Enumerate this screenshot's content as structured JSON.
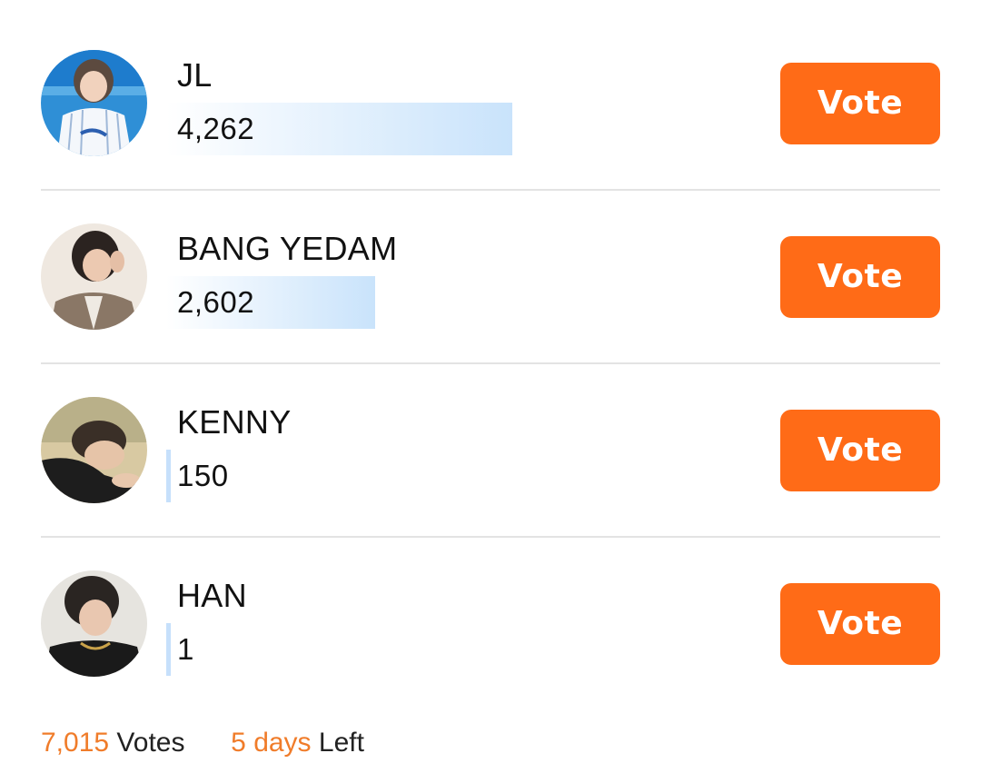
{
  "colors": {
    "accent": "#ff6b17",
    "footer_accent": "#f07c2a",
    "bar": "#c9e3fb",
    "divider": "#e3e3e3"
  },
  "candidates": [
    {
      "name": "JL",
      "votes": "4,262",
      "vote_label": "Vote"
    },
    {
      "name": "BANG YEDAM",
      "votes": "2,602",
      "vote_label": "Vote"
    },
    {
      "name": "KENNY",
      "votes": "150",
      "vote_label": "Vote"
    },
    {
      "name": "HAN",
      "votes": "1",
      "vote_label": "Vote"
    }
  ],
  "footer": {
    "total_votes": "7,015",
    "votes_label": "Votes",
    "days": "5 days",
    "left_label": "Left"
  }
}
